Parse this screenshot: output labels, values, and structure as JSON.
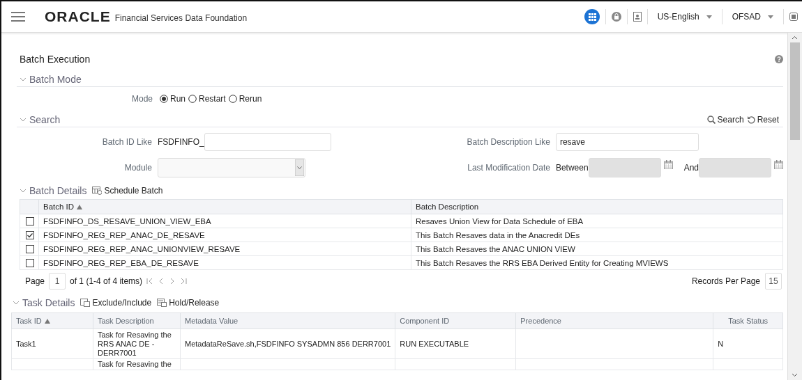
{
  "header": {
    "logo": "ORACLE",
    "app_title": "Financial Services Data Foundation",
    "language": "US-English",
    "user": "OFSAD"
  },
  "page_title": "Batch Execution",
  "batch_mode": {
    "title": "Batch Mode",
    "label": "Mode",
    "options": [
      {
        "label": "Run",
        "selected": true
      },
      {
        "label": "Restart",
        "selected": false
      },
      {
        "label": "Rerun",
        "selected": false
      }
    ]
  },
  "search": {
    "title": "Search",
    "search_button": "Search",
    "reset_button": "Reset",
    "batch_id_label": "Batch ID Like",
    "batch_id_prefix": "FSDFINFO_",
    "description_label": "Batch Description Like",
    "description_value": "resave",
    "module_label": "Module",
    "date_label": "Last Modification Date",
    "between_label": "Between",
    "and_label": "And"
  },
  "batch_details": {
    "title": "Batch Details",
    "action": "Schedule Batch",
    "columns": [
      "Batch ID",
      "Batch Description"
    ],
    "rows": [
      {
        "checked": false,
        "batch_id": "FSDFINFO_DS_RESAVE_UNION_VIEW_EBA",
        "description": "Resaves Union View for Data Schedule of EBA"
      },
      {
        "checked": true,
        "batch_id": "FSDFINFO_REG_REP_ANAC_DE_RESAVE",
        "description": "This Batch Resaves data in the Anacredit DEs"
      },
      {
        "checked": false,
        "batch_id": "FSDFINFO_REG_REP_ANAC_UNIONVIEW_RESAVE",
        "description": "This Batch Resaves the ANAC UNION VIEW"
      },
      {
        "checked": false,
        "batch_id": "FSDFINFO_REG_REP_EBA_DE_RESAVE",
        "description": "This Batch Resaves the RRS EBA Derived Entity for Creating MVIEWS"
      }
    ],
    "pager": {
      "page_label": "Page",
      "page_value": "1",
      "info": "of 1 (1-4 of 4 items)",
      "records_label": "Records Per Page",
      "records_value": "15"
    }
  },
  "task_details": {
    "title": "Task Details",
    "actions": [
      "Exclude/Include",
      "Hold/Release"
    ],
    "columns": [
      "Task ID",
      "Task Description",
      "Metadata Value",
      "Component ID",
      "Precedence",
      "Task Status"
    ],
    "rows": [
      {
        "task_id": "Task1",
        "task_description": "Task for Resaving the RRS ANAC DE - DERR7001",
        "metadata_value": "MetadataReSave.sh,FSDFINFO SYSADMN 856 DERR7001",
        "component_id": "RUN EXECUTABLE",
        "task_status": "N"
      },
      {
        "task_description": "Task for Resaving the"
      }
    ]
  }
}
